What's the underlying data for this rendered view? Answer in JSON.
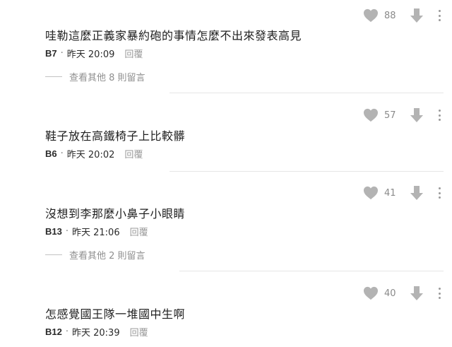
{
  "comments": [
    {
      "likes": "88",
      "content": "哇勒這麼正義家暴約砲的事情怎麼不出來發表高見",
      "floor": "B7",
      "sep": "·",
      "time": "昨天 20:09",
      "reply_label": "回覆",
      "view_more": "查看其他 8 則留言"
    },
    {
      "likes": "57",
      "content": "鞋子放在高鐵椅子上比較髒",
      "floor": "B6",
      "sep": "·",
      "time": "昨天 20:02",
      "reply_label": "回覆"
    },
    {
      "likes": "41",
      "content": "沒想到李那麼小鼻子小眼睛",
      "floor": "B13",
      "sep": "·",
      "time": "昨天 21:06",
      "reply_label": "回覆",
      "view_more": "查看其他 2 則留言"
    },
    {
      "likes": "40",
      "content": "怎感覺國王隊一堆國中生啊",
      "floor": "B12",
      "sep": "·",
      "time": "昨天 20:39",
      "reply_label": "回覆"
    }
  ],
  "icons": {
    "like": "heart-icon",
    "dislike": "thumb-down-arrow-icon",
    "more": "more-vertical-icon"
  },
  "colors": {
    "icon": "#b3b3b3",
    "text": "#1f1f1f",
    "muted": "#8f8f8f",
    "divider": "#e6e6e6"
  }
}
